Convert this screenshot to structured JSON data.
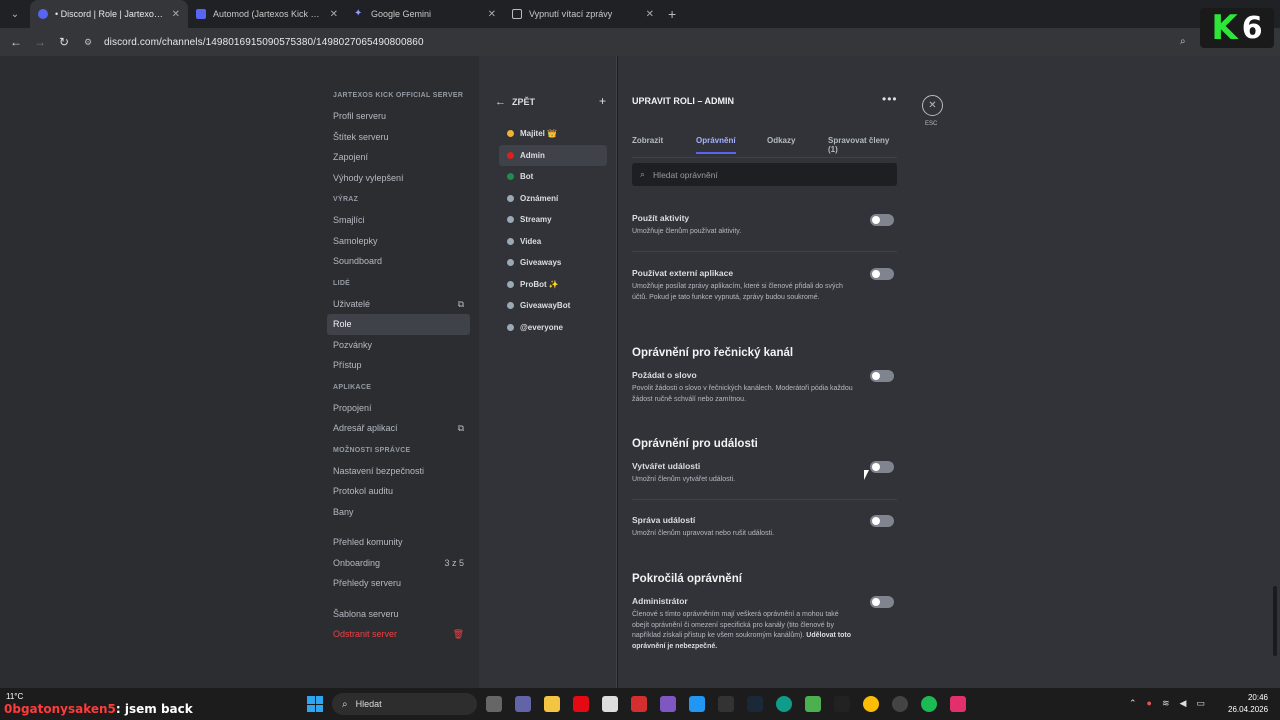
{
  "browser": {
    "tabs": [
      {
        "title": "• Discord | Role | Jartexos Kick o",
        "active": true,
        "color": "#5865f2"
      },
      {
        "title": "Automod (Jartexos Kick official",
        "active": false,
        "color": "#5865f2"
      },
      {
        "title": "Google Gemini",
        "active": false,
        "color": "#8e7cff"
      },
      {
        "title": "Vypnutí vítací zprávy",
        "active": false,
        "color": "#bbbbbb"
      }
    ],
    "url": "discord.com/channels/1498016915090575380/1498027065490800860",
    "logo_k": "K",
    "logo_6": "6"
  },
  "settings_nav": {
    "server_section": "JARTEXOS KICK OFFICIAL SERVER",
    "server_items": [
      "Profil serveru",
      "Štítek serveru",
      "Zapojení",
      "Výhody vylepšení"
    ],
    "expression_section": "VÝRAZ",
    "expression_items": [
      "Smajlíci",
      "Samolepky",
      "Soundboard"
    ],
    "people_section": "LIDÉ",
    "people_items": [
      "Uživatelé",
      "Role",
      "Pozvánky",
      "Přístup"
    ],
    "apps_section": "APLIKACE",
    "apps_items": [
      "Propojení",
      "Adresář aplikací"
    ],
    "mod_section": "MOŽNOSTI SPRÁVCE",
    "mod_items": [
      "Nastavení bezpečnosti",
      "Protokol auditu",
      "Bany"
    ],
    "community_items": [
      "Přehled komunity",
      "Onboarding",
      "Přehledy serveru"
    ],
    "onboarding_count": "3 z 5",
    "template_item": "Šablona serveru",
    "delete_item": "Odstranit server"
  },
  "roles": {
    "back_label": "ZPĚT",
    "list": [
      {
        "name": "Majitel 👑",
        "color": "#f0b232"
      },
      {
        "name": "Admin",
        "color": "#e01e1e"
      },
      {
        "name": "Bot",
        "color": "#1f8b4c"
      },
      {
        "name": "Oznámení",
        "color": "#99aab5"
      },
      {
        "name": "Streamy",
        "color": "#99aab5"
      },
      {
        "name": "Videa",
        "color": "#99aab5"
      },
      {
        "name": "Giveaways",
        "color": "#99aab5"
      },
      {
        "name": "ProBot ✨",
        "color": "#99aab5"
      },
      {
        "name": "GiveawayBot",
        "color": "#99aab5"
      },
      {
        "name": "@everyone",
        "color": "#99aab5"
      }
    ]
  },
  "edit": {
    "title": "UPRAVIT ROLI – ADMIN",
    "esc_label": "ESC",
    "tabs": [
      "Zobrazit",
      "Oprávnění",
      "Odkazy",
      "Spravovat členy (1)"
    ],
    "search_placeholder": "Hledat oprávnění",
    "perm1": {
      "name": "Použít aktivity",
      "desc": "Umožňuje členům používat aktivity.",
      "enabled": false
    },
    "perm2": {
      "name": "Používat externí aplikace",
      "desc": "Umožňuje posílat zprávy aplikacím, které si členové přidali do svých účtů. Pokud je tato funkce vypnutá, zprávy budou soukromé.",
      "enabled": false
    },
    "section_stage": "Oprávnění pro řečnický kanál",
    "perm3": {
      "name": "Požádat o slovo",
      "desc": "Povolit žádosti o slovo v řečnických kanálech. Moderátoři pódia každou žádost ručně schválí nebo zamítnou.",
      "enabled": false
    },
    "section_events": "Oprávnění pro události",
    "perm4": {
      "name": "Vytvářet události",
      "desc": "Umožní členům vytvářet události.",
      "enabled": false
    },
    "perm5": {
      "name": "Správa událostí",
      "desc": "Umožní členům upravovat nebo rušit události.",
      "enabled": false
    },
    "section_advanced": "Pokročilá oprávnění",
    "perm6": {
      "name": "Administrátor",
      "desc": "Členové s tímto oprávněním mají veškerá oprávnění a mohou také obejít oprávnění či omezení specifická pro kanály (tito členové by například získali přístup ke všem soukromým kanálům).",
      "desc_bold": "Udělovat toto oprávnění je nebezpečné.",
      "enabled": false
    }
  },
  "taskbar": {
    "temperature": "11°C",
    "chat_user": "0bgatonysaken5",
    "chat_msg": ": jsem back",
    "search": "Hledat",
    "time": "20:46",
    "date": "26.04.2026"
  }
}
